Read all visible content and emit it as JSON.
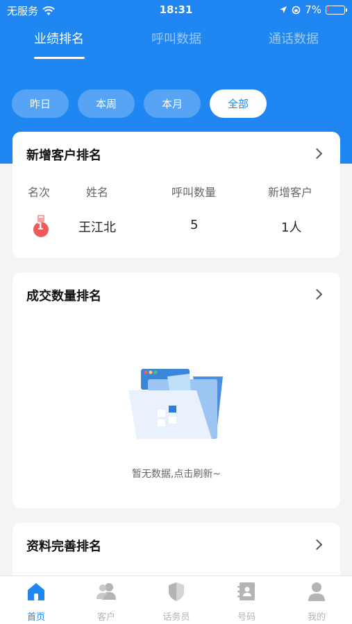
{
  "status_bar": {
    "carrier": "无服务",
    "time": "18:31",
    "battery_percent": "7%",
    "battery_level": 0.07
  },
  "top_tabs": [
    {
      "label": "业绩排名",
      "active": true
    },
    {
      "label": "呼叫数据",
      "active": false
    },
    {
      "label": "通话数据",
      "active": false
    }
  ],
  "filters": [
    {
      "label": "昨日",
      "active": false
    },
    {
      "label": "本周",
      "active": false
    },
    {
      "label": "本月",
      "active": false
    },
    {
      "label": "全部",
      "active": true
    }
  ],
  "new_customer_card": {
    "title": "新增客户排名",
    "columns": [
      "名次",
      "姓名",
      "呼叫数量",
      "新增客户"
    ],
    "rows": [
      {
        "rank": "1",
        "name": "王江北",
        "calls": "5",
        "new_customers": "1人"
      }
    ]
  },
  "deals_card": {
    "title": "成交数量排名",
    "empty_text": "暂无数据,点击刷新~"
  },
  "profile_card": {
    "title": "资料完善排名"
  },
  "bottom_nav": [
    {
      "label": "首页",
      "icon": "home-icon",
      "active": true
    },
    {
      "label": "客户",
      "icon": "customers-icon",
      "active": false
    },
    {
      "label": "话务员",
      "icon": "shield-icon",
      "active": false
    },
    {
      "label": "号码",
      "icon": "contacts-book-icon",
      "active": false
    },
    {
      "label": "我的",
      "icon": "user-icon",
      "active": false
    }
  ],
  "colors": {
    "brand_blue": "#1f86f2",
    "battery_low": "#ff4b4b",
    "medal_red": "#f05a5a"
  }
}
